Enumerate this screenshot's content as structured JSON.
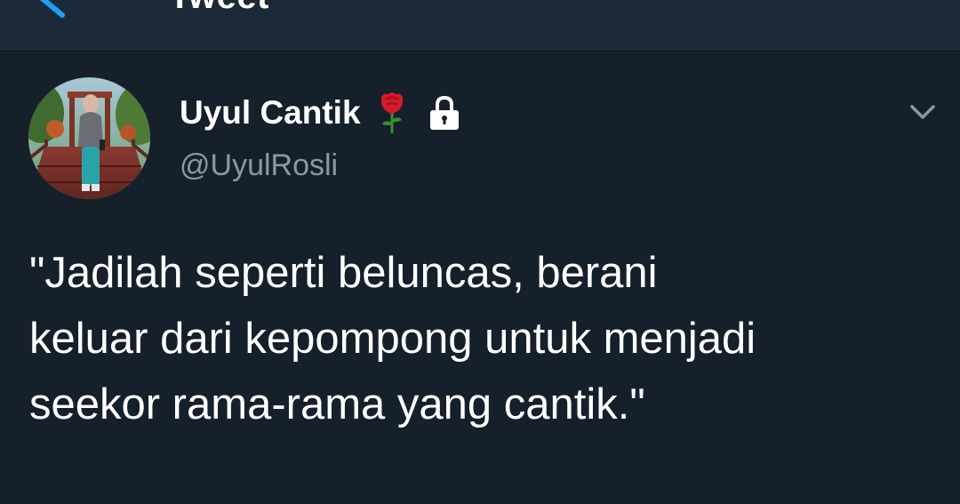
{
  "header": {
    "title": "Tweet",
    "back_icon": "back-arrow-icon"
  },
  "tweet": {
    "display_name": "Uyul Cantik",
    "name_emoji_icon": "rose-icon",
    "protected_icon": "lock-icon",
    "handle": "@UyulRosli",
    "more_icon": "chevron-down-icon",
    "text": "\"Jadilah seperti beluncas, berani\nkeluar dari kepompong untuk menjadi\nseekor rama-rama yang cantik.\""
  },
  "colors": {
    "background": "#15202b",
    "header_background": "#1c2938",
    "accent": "#1da1f2",
    "secondary_text": "#8899a6",
    "primary_text": "#ffffff"
  }
}
